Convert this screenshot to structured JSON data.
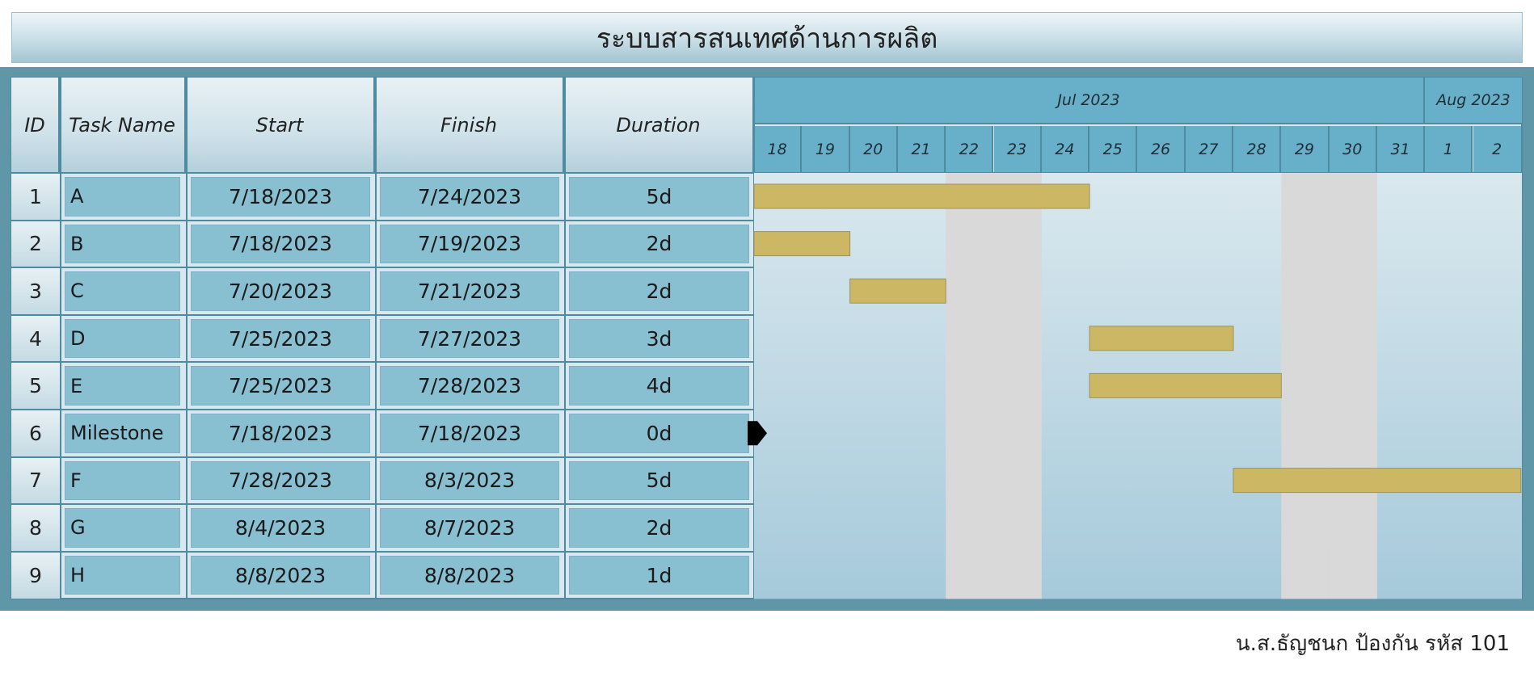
{
  "title": "ระบบสารสนเทศด้านการผลิต",
  "headers": {
    "id": "ID",
    "task_name": "Task Name",
    "start": "Start",
    "finish": "Finish",
    "duration": "Duration"
  },
  "months": [
    "Jul 2023",
    "Aug 2023"
  ],
  "days": [
    "18",
    "19",
    "20",
    "21",
    "22",
    "23",
    "24",
    "25",
    "26",
    "27",
    "28",
    "29",
    "30",
    "31",
    "1",
    "2"
  ],
  "tasks": [
    {
      "id": "1",
      "name": "A",
      "start": "7/18/2023",
      "finish": "7/24/2023",
      "duration": "5d"
    },
    {
      "id": "2",
      "name": "B",
      "start": "7/18/2023",
      "finish": "7/19/2023",
      "duration": "2d"
    },
    {
      "id": "3",
      "name": "C",
      "start": "7/20/2023",
      "finish": "7/21/2023",
      "duration": "2d"
    },
    {
      "id": "4",
      "name": "D",
      "start": "7/25/2023",
      "finish": "7/27/2023",
      "duration": "3d"
    },
    {
      "id": "5",
      "name": "E",
      "start": "7/25/2023",
      "finish": "7/28/2023",
      "duration": "4d"
    },
    {
      "id": "6",
      "name": "Milestone",
      "start": "7/18/2023",
      "finish": "7/18/2023",
      "duration": "0d"
    },
    {
      "id": "7",
      "name": "F",
      "start": "7/28/2023",
      "finish": "8/3/2023",
      "duration": "5d"
    },
    {
      "id": "8",
      "name": "G",
      "start": "8/4/2023",
      "finish": "8/7/2023",
      "duration": "2d"
    },
    {
      "id": "9",
      "name": "H",
      "start": "8/8/2023",
      "finish": "8/8/2023",
      "duration": "1d"
    }
  ],
  "footer": "น.ส.ธัญชนก ป้องกัน รหัส 101",
  "chart_data": {
    "type": "gantt",
    "x_range": [
      "7/18/2023",
      "8/2/2023"
    ],
    "weekend_days": [
      "22",
      "23",
      "29",
      "30"
    ],
    "bars": [
      {
        "task": "A",
        "start": "7/18/2023",
        "finish": "7/24/2023"
      },
      {
        "task": "B",
        "start": "7/18/2023",
        "finish": "7/19/2023"
      },
      {
        "task": "C",
        "start": "7/20/2023",
        "finish": "7/21/2023"
      },
      {
        "task": "D",
        "start": "7/25/2023",
        "finish": "7/27/2023"
      },
      {
        "task": "E",
        "start": "7/25/2023",
        "finish": "7/28/2023"
      },
      {
        "task": "Milestone",
        "start": "7/18/2023",
        "finish": "7/18/2023",
        "milestone": true
      },
      {
        "task": "F",
        "start": "7/28/2023",
        "finish": "8/3/2023"
      },
      {
        "task": "G",
        "start": "8/4/2023",
        "finish": "8/7/2023"
      },
      {
        "task": "H",
        "start": "8/8/2023",
        "finish": "8/8/2023"
      }
    ],
    "colors": {
      "bar": "#ccb864",
      "bar_border": "#9a9360",
      "weekend": "#d9d9d9",
      "grid_bg": "#b9d6e2",
      "milestone": "#000000"
    }
  }
}
